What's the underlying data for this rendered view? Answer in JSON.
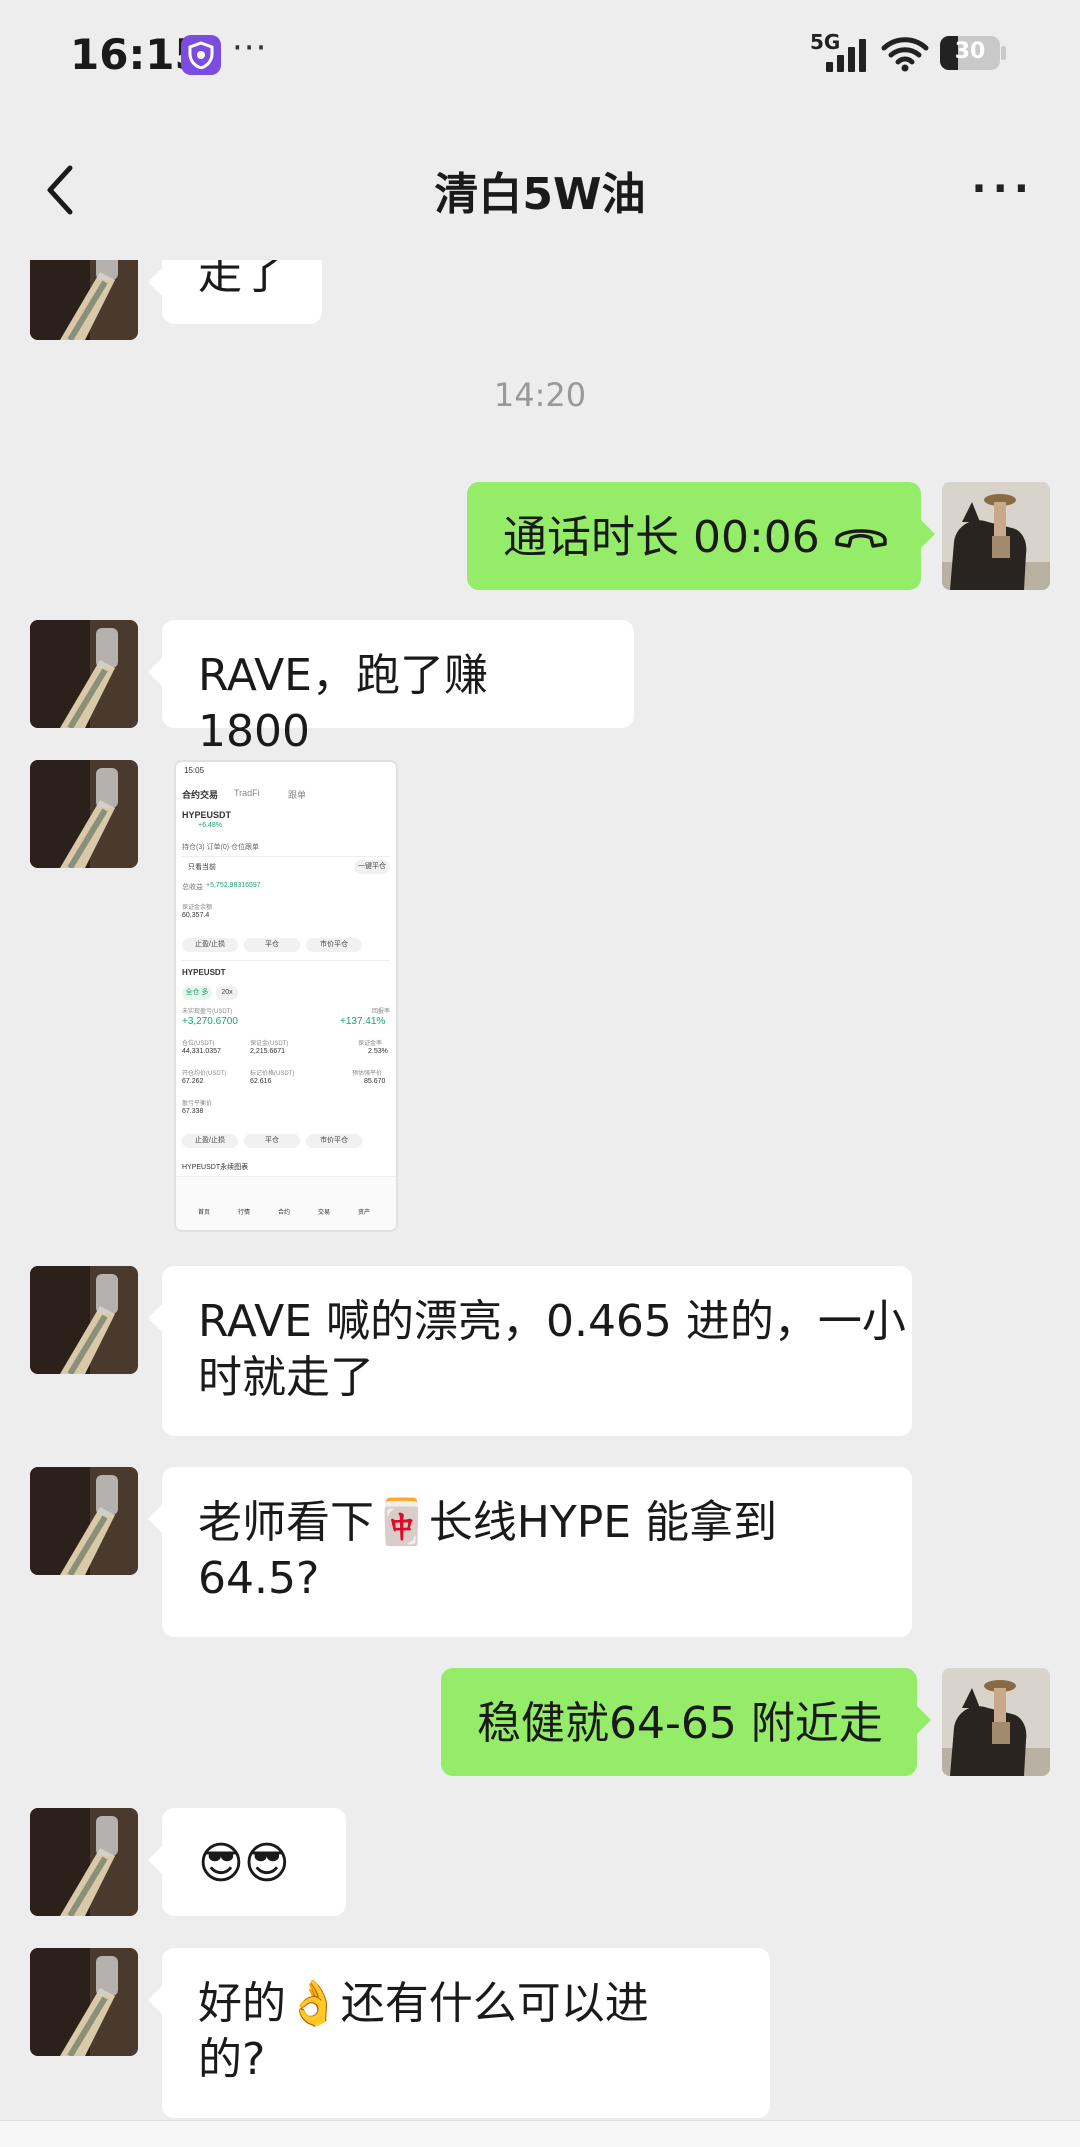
{
  "status_bar": {
    "time": "16:15",
    "more": "···",
    "network": "5G",
    "battery": "30"
  },
  "nav": {
    "title": "清白5W油",
    "more": "···"
  },
  "messages": {
    "m0_text": "走了",
    "timestamp": "14:20",
    "call_text": "通话时长 00:06",
    "m1_text": "RAVE，跑了赚1800",
    "m3_line1": "RAVE 喊的漂亮，0.465 进的，一小",
    "m3_line2": "时就走了",
    "m4_line1_a": "老师看下",
    "m4_line1_emoji": "🀄",
    "m4_line1_b": "长线HYPE 能拿到",
    "m4_line2": "64.5?",
    "m5_text": "稳健就64-65 附近走",
    "m6_text": "😎😎",
    "m7_line1_a": "好的",
    "m7_line1_emoji": "👌",
    "m7_line1_b": "还有什么可以进",
    "m7_line2": "的?"
  },
  "screenshot": {
    "time": "15:05",
    "tab1": "合约交易",
    "tab2": "TradFi",
    "tab3": "跟单",
    "pair": "HYPEUSDT",
    "change": "+6.48%",
    "pos_tabs": "持仓(3)   订单(0)   仓位跟单",
    "only_current": "只看当前",
    "close_all": "一键平仓",
    "pnl_label": "总收益",
    "pnl_value": "+5,752.98316597",
    "margin_label": "保证金余额",
    "margin_value": "60,357.4",
    "btn_tpsl": "止盈/止损",
    "btn_close": "平仓",
    "btn_market_close": "市价平仓",
    "pos_pair": "HYPEUSDT",
    "pos_mode": "全仓 多",
    "pos_leverage": "20x",
    "unreal_label": "未实现盈亏(USDT)",
    "unreal_value": "+3,270.6700",
    "roe_label": "回报率",
    "roe_value": "+137.41%",
    "size_label": "仓位(USDT)",
    "size_value": "44,331.0357",
    "margin2_label": "保证金(USDT)",
    "margin2_value": "2,215.6671",
    "ratio_label": "保证金率",
    "ratio_value": "2.53%",
    "entry_label": "开仓均价(USDT)",
    "entry_value": "67.262",
    "mark_label": "标记价格(USDT)",
    "mark_value": "62.616",
    "liq_label": "预估强平价",
    "liq_value": "85.670",
    "breakeven_label": "盈亏平衡价",
    "breakeven_value": "67.338",
    "chart_label": "HYPEUSDT永续图表",
    "nav_items": [
      "首页",
      "行情",
      "合约",
      "交易",
      "资产"
    ]
  }
}
